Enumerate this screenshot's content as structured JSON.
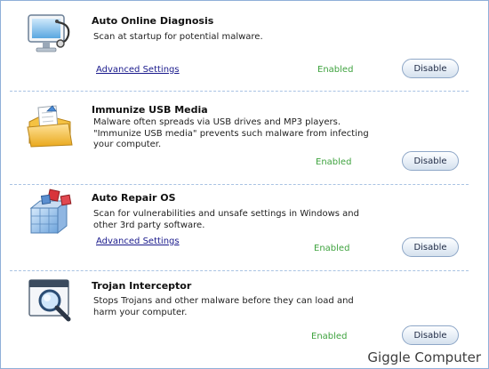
{
  "features": [
    {
      "title": "Auto Online Diagnosis",
      "desc_lines": [
        "Scan at startup for potential malware."
      ],
      "link": "Advanced Settings",
      "status": "Enabled",
      "button": "Disable",
      "icon": "monitor-stethoscope-icon"
    },
    {
      "title": "Immunize USB Media",
      "desc_lines": [
        "Malware often spreads via USB drives and MP3 players.",
        "\"Immunize USB media\" prevents such malware from infecting",
        "your computer."
      ],
      "status": "Enabled",
      "button": "Disable",
      "icon": "folder-shield-icon"
    },
    {
      "title": "Auto Repair OS",
      "desc_lines": [
        "Scan for vulnerabilities and unsafe settings in Windows and",
        "other 3rd party software."
      ],
      "link": "Advanced Settings",
      "status": "Enabled",
      "button": "Disable",
      "icon": "cubes-icon"
    },
    {
      "title": "Trojan Interceptor",
      "desc_lines": [
        "Stops Trojans and other malware before they can load and",
        "harm your computer."
      ],
      "status": "Enabled",
      "button": "Disable",
      "icon": "window-magnifier-icon"
    }
  ],
  "watermark": "Giggle Computer",
  "colors": {
    "status_green": "#3fa33f",
    "link_blue": "#1a1a8c",
    "divider": "#a9c3e3",
    "border": "#8fb0d8"
  }
}
